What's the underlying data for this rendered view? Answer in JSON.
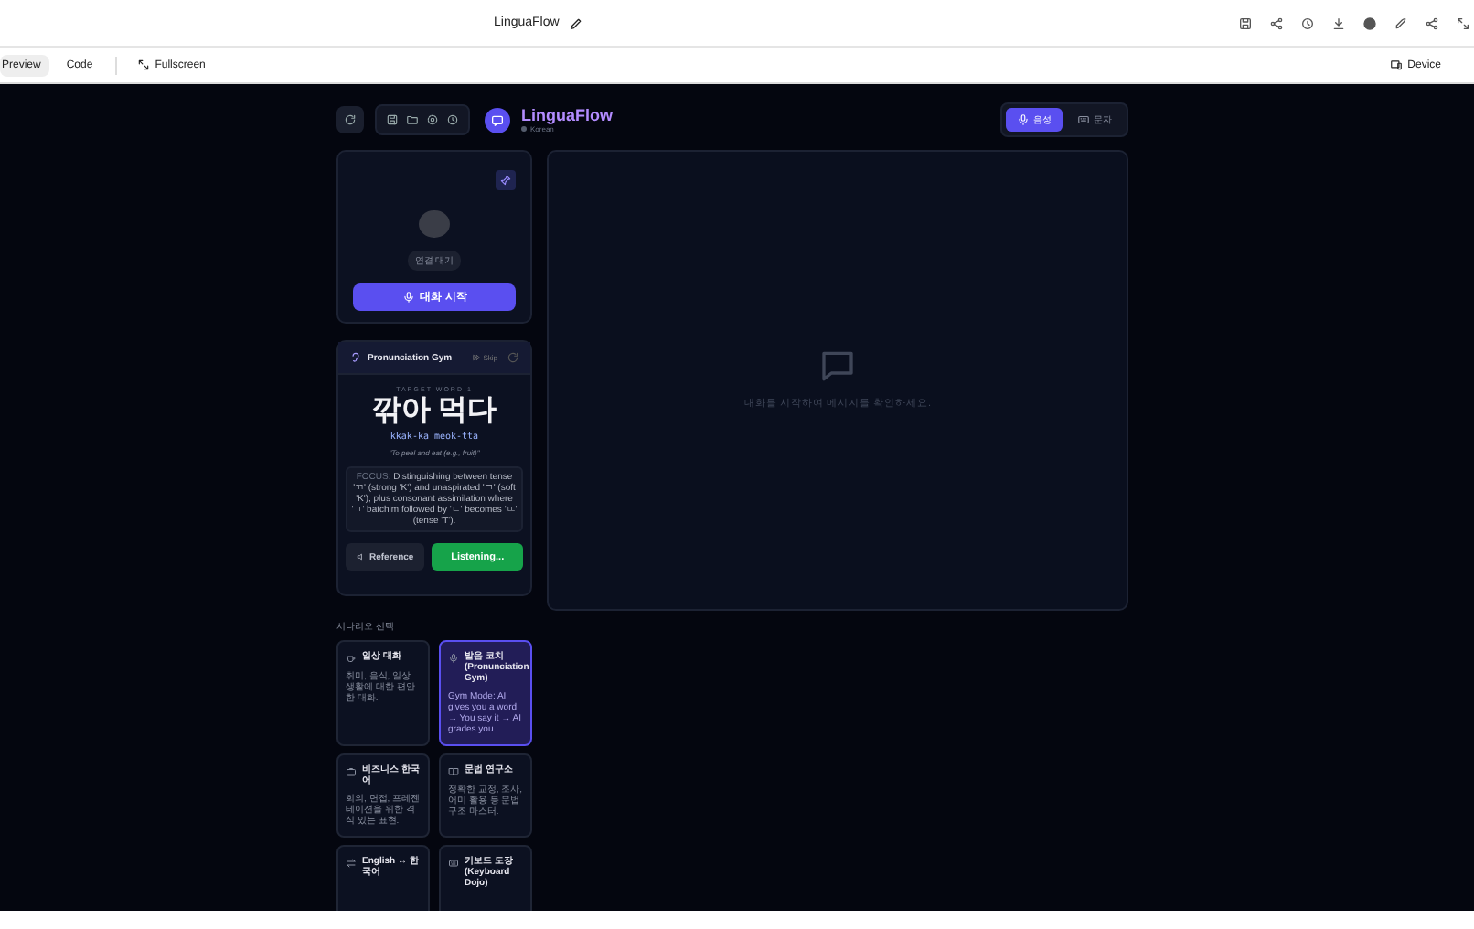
{
  "top_bar": {
    "title": "LinguaFlow"
  },
  "toolbar": {
    "tabs": [
      {
        "label": "Preview",
        "selected": true
      },
      {
        "label": "Code",
        "selected": false
      }
    ],
    "fullscreen": "Fullscreen",
    "device": "Device"
  },
  "header": {
    "title": "LinguaFlow",
    "language": "Korean"
  },
  "mode_toggle": [
    {
      "label": "음성",
      "kind": "voice",
      "selected": true
    },
    {
      "label": "문자",
      "kind": "text",
      "selected": false
    }
  ],
  "session": {
    "status": "연결 대기",
    "start_button": "대화 시작"
  },
  "gym": {
    "title": "Pronunciation Gym",
    "skip": "Skip",
    "target_label": "TARGET WORD 1",
    "word": "깎아 먹다",
    "romanization": "kkak-ka meok-tta",
    "translation": "\"To peel and eat (e.g., fruit)\"",
    "focus_label": "FOCUS:",
    "focus_text": "Distinguishing between tense 'ㄲ' (strong 'K') and unaspirated 'ㄱ' (soft 'K'), plus consonant assimilation where 'ㄱ' batchim followed by 'ㄷ' becomes 'ㄸ' (tense 'T').",
    "buttons": [
      {
        "label": "Reference",
        "kind": "reference"
      },
      {
        "label": "Listening...",
        "kind": "listening"
      }
    ]
  },
  "chat": {
    "empty_message": "대화를 시작하여 메시지를 확인하세요."
  },
  "scenarios": {
    "heading": "시나리오 선택",
    "items": [
      {
        "kind": "cup",
        "title": "일상 대화",
        "description": "취미, 음식, 일상 생활에 대한 편안한 대화.",
        "selected": false
      },
      {
        "kind": "mic",
        "title": "발음 코치 (Pronunciation Gym)",
        "description": "Gym Mode: AI gives you a word → You say it → AI grades you.",
        "selected": true
      },
      {
        "kind": "briefcase",
        "title": "비즈니스 한국어",
        "description": "회의, 면접, 프레젠테이션을 위한 격식 있는 표현.",
        "selected": false
      },
      {
        "kind": "book",
        "title": "문법 연구소",
        "description": "정확한 교정, 조사, 어미 활용 등 문법 구조 마스터.",
        "selected": false
      },
      {
        "kind": "swap",
        "title": "English ↔ 한국어",
        "selected": false
      },
      {
        "kind": "keyboard",
        "title": "키보드 도장 (Keyboard Dojo)",
        "selected": false
      }
    ]
  }
}
